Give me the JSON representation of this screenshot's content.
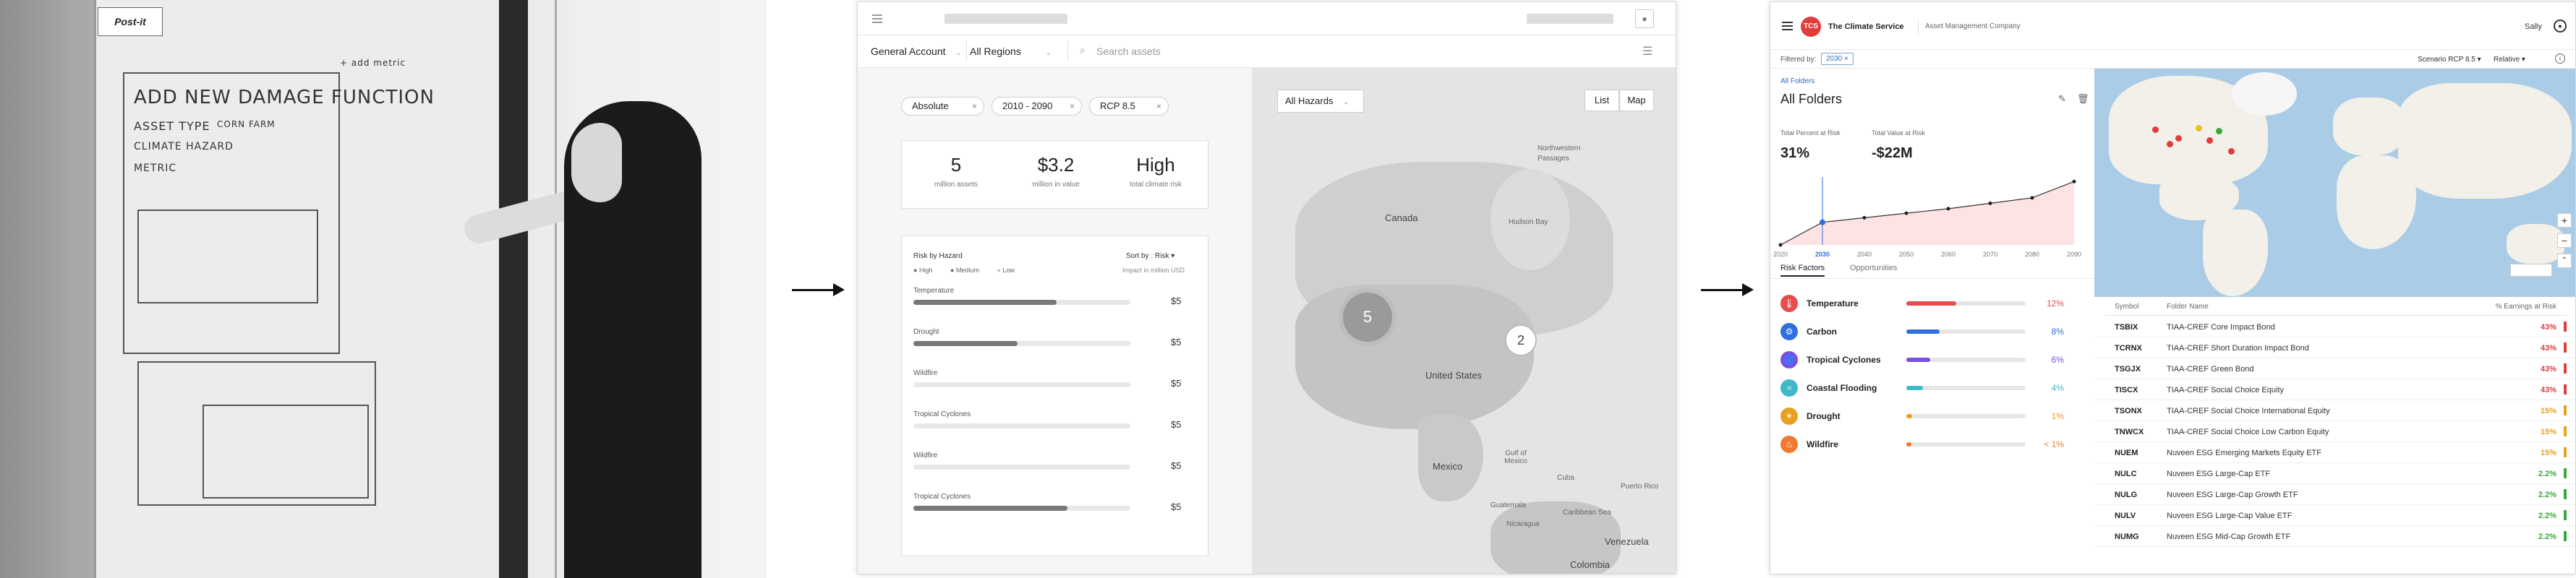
{
  "photo": {
    "postit_brand": "Post-it",
    "sketch_title": "ADD NEW DAMAGE FUNCTION",
    "sketch_asset_type": "ASSET TYPE",
    "sketch_asset_value": "CORN FARM",
    "sketch_climate_hazard": "CLIMATE HAZARD",
    "sketch_metric": "METRIC",
    "sketch_add_metric": "+ add metric"
  },
  "wireframe": {
    "filters": {
      "account": "General Account",
      "regions": "All Regions",
      "search_placeholder": "Search assets"
    },
    "chips": [
      "Absolute",
      "2010 - 2090",
      "RCP 8.5"
    ],
    "kpis": [
      {
        "value": "5",
        "label": "million assets"
      },
      {
        "value": "$3.2",
        "label": "million in value"
      },
      {
        "value": "High",
        "label": "total climate risk"
      }
    ],
    "hazards": {
      "title": "Risk by Hazard",
      "sort_label": "Sort by : Risk",
      "legend": [
        "High",
        "Medium",
        "Low"
      ],
      "unit_note": "Impact in million USD",
      "rows": [
        {
          "name": "Temperature",
          "value": "$5",
          "fill": 0.66
        },
        {
          "name": "Drought",
          "value": "$5",
          "fill": 0.48
        },
        {
          "name": "Wildfire",
          "value": "$5",
          "fill": 0.0
        },
        {
          "name": "Tropical Cyclones",
          "value": "$5",
          "fill": 0.0
        },
        {
          "name": "Wildfire",
          "value": "$5",
          "fill": 0.0
        },
        {
          "name": "Tropical Cyclones",
          "value": "$5",
          "fill": 0.71
        }
      ]
    },
    "map": {
      "hazard_select": "All Hazards",
      "list_btn": "List",
      "map_btn": "Map",
      "cluster_large": "5",
      "cluster_small": "2",
      "labels": {
        "canada": "Canada",
        "hudson": "Hudson Bay",
        "nw_passages": "Northwestern Passages",
        "us": "United States",
        "mexico": "Mexico",
        "gulf": "Gulf of Mexico",
        "cuba": "Cuba",
        "puerto_rico": "Puerto Rico",
        "caribbean": "Caribbean Sea",
        "guatemala": "Guatemala",
        "nicaragua": "Nicaragua",
        "venezuela": "Venezuela",
        "colombia": "Colombia"
      }
    }
  },
  "ui": {
    "header": {
      "logo": "TCS",
      "brand": "The Climate Service",
      "company": "Asset Management Company",
      "user": "Sally"
    },
    "subbar": {
      "filtered_by": "Filtered by:",
      "filter_chip": "2030",
      "scenario": "Scenario RCP 8.5",
      "mode": "Relative"
    },
    "folder": {
      "breadcrumb": "All Folders",
      "title": "All Folders",
      "kpi1_label": "Total Percent at Risk",
      "kpi1_value": "31%",
      "kpi2_label": "Total Value at Risk",
      "kpi2_value": "-$22M"
    },
    "chart_data": {
      "type": "line",
      "x": [
        2020,
        2030,
        2040,
        2050,
        2060,
        2070,
        2080,
        2090
      ],
      "tick_labels": [
        "2020",
        "2030",
        "2040",
        "2050",
        "2060",
        "2070",
        "2080",
        "2090"
      ],
      "series": [
        {
          "values": [
            0.0,
            0.25,
            0.3,
            0.35,
            0.4,
            0.46,
            0.52,
            0.7
          ]
        }
      ],
      "highlight_x": 2030,
      "xlim": [
        2020,
        2090
      ],
      "ylim": [
        0,
        0.75
      ]
    },
    "tabs": [
      "Risk Factors",
      "Opportunities"
    ],
    "risk_factors": [
      {
        "name": "Temperature",
        "value": "12%",
        "fraction": 0.42,
        "color": "#e84c4c",
        "icon": "thermometer-icon",
        "glyph": "🌡"
      },
      {
        "name": "Carbon",
        "value": "8%",
        "fraction": 0.28,
        "color": "#2f6fe0",
        "icon": "carbon-icon",
        "glyph": "⚙"
      },
      {
        "name": "Tropical Cyclones",
        "value": "6%",
        "fraction": 0.2,
        "color": "#7b4fe0",
        "icon": "cyclone-icon",
        "glyph": "🌀"
      },
      {
        "name": "Coastal Flooding",
        "value": "4%",
        "fraction": 0.14,
        "color": "#3fb8c8",
        "icon": "wave-icon",
        "glyph": "≈"
      },
      {
        "name": "Drought",
        "value": "1%",
        "fraction": 0.05,
        "color": "#e8a020",
        "icon": "sun-icon",
        "glyph": "☀"
      },
      {
        "name": "Wildfire",
        "value": "< 1%",
        "fraction": 0.04,
        "color": "#f07a30",
        "icon": "flame-icon",
        "glyph": "♨"
      }
    ],
    "table": {
      "headers": {
        "symbol": "Symbol",
        "name": "Folder Name",
        "earnings": "% Earnings at Risk"
      },
      "rows": [
        {
          "symbol": "TSBIX",
          "name": "TIAA-CREF Core Impact Bond",
          "value": "43%",
          "color": "#e23c3c"
        },
        {
          "symbol": "TCRNX",
          "name": "TIAA-CREF Short Duration Impact Bond",
          "value": "43%",
          "color": "#e23c3c"
        },
        {
          "symbol": "TSGJX",
          "name": "TIAA-CREF Green Bond",
          "value": "43%",
          "color": "#e23c3c"
        },
        {
          "symbol": "TISCX",
          "name": "TIAA-CREF Social Choice Equity",
          "value": "43%",
          "color": "#e23c3c"
        },
        {
          "symbol": "TSONX",
          "name": "TIAA-CREF Social Choice International Equity",
          "value": "15%",
          "color": "#e8a020"
        },
        {
          "symbol": "TNWCX",
          "name": "TIAA-CREF Social Choice Low Carbon Equity",
          "value": "15%",
          "color": "#e8a020"
        },
        {
          "symbol": "NUEM",
          "name": "Nuveen ESG Emerging Markets Equity ETF",
          "value": "15%",
          "color": "#e8a020"
        },
        {
          "symbol": "NULC",
          "name": "Nuveen ESG Large-Cap ETF",
          "value": "2.2%",
          "color": "#3aa83a"
        },
        {
          "symbol": "NULG",
          "name": "Nuveen ESG Large-Cap Growth ETF",
          "value": "2.2%",
          "color": "#3aa83a"
        },
        {
          "symbol": "NULV",
          "name": "Nuveen ESG Large-Cap Value ETF",
          "value": "2.2%",
          "color": "#3aa83a"
        },
        {
          "symbol": "NUMG",
          "name": "Nuveen ESG Mid-Cap Growth ETF",
          "value": "2.2%",
          "color": "#3aa83a"
        }
      ]
    }
  }
}
